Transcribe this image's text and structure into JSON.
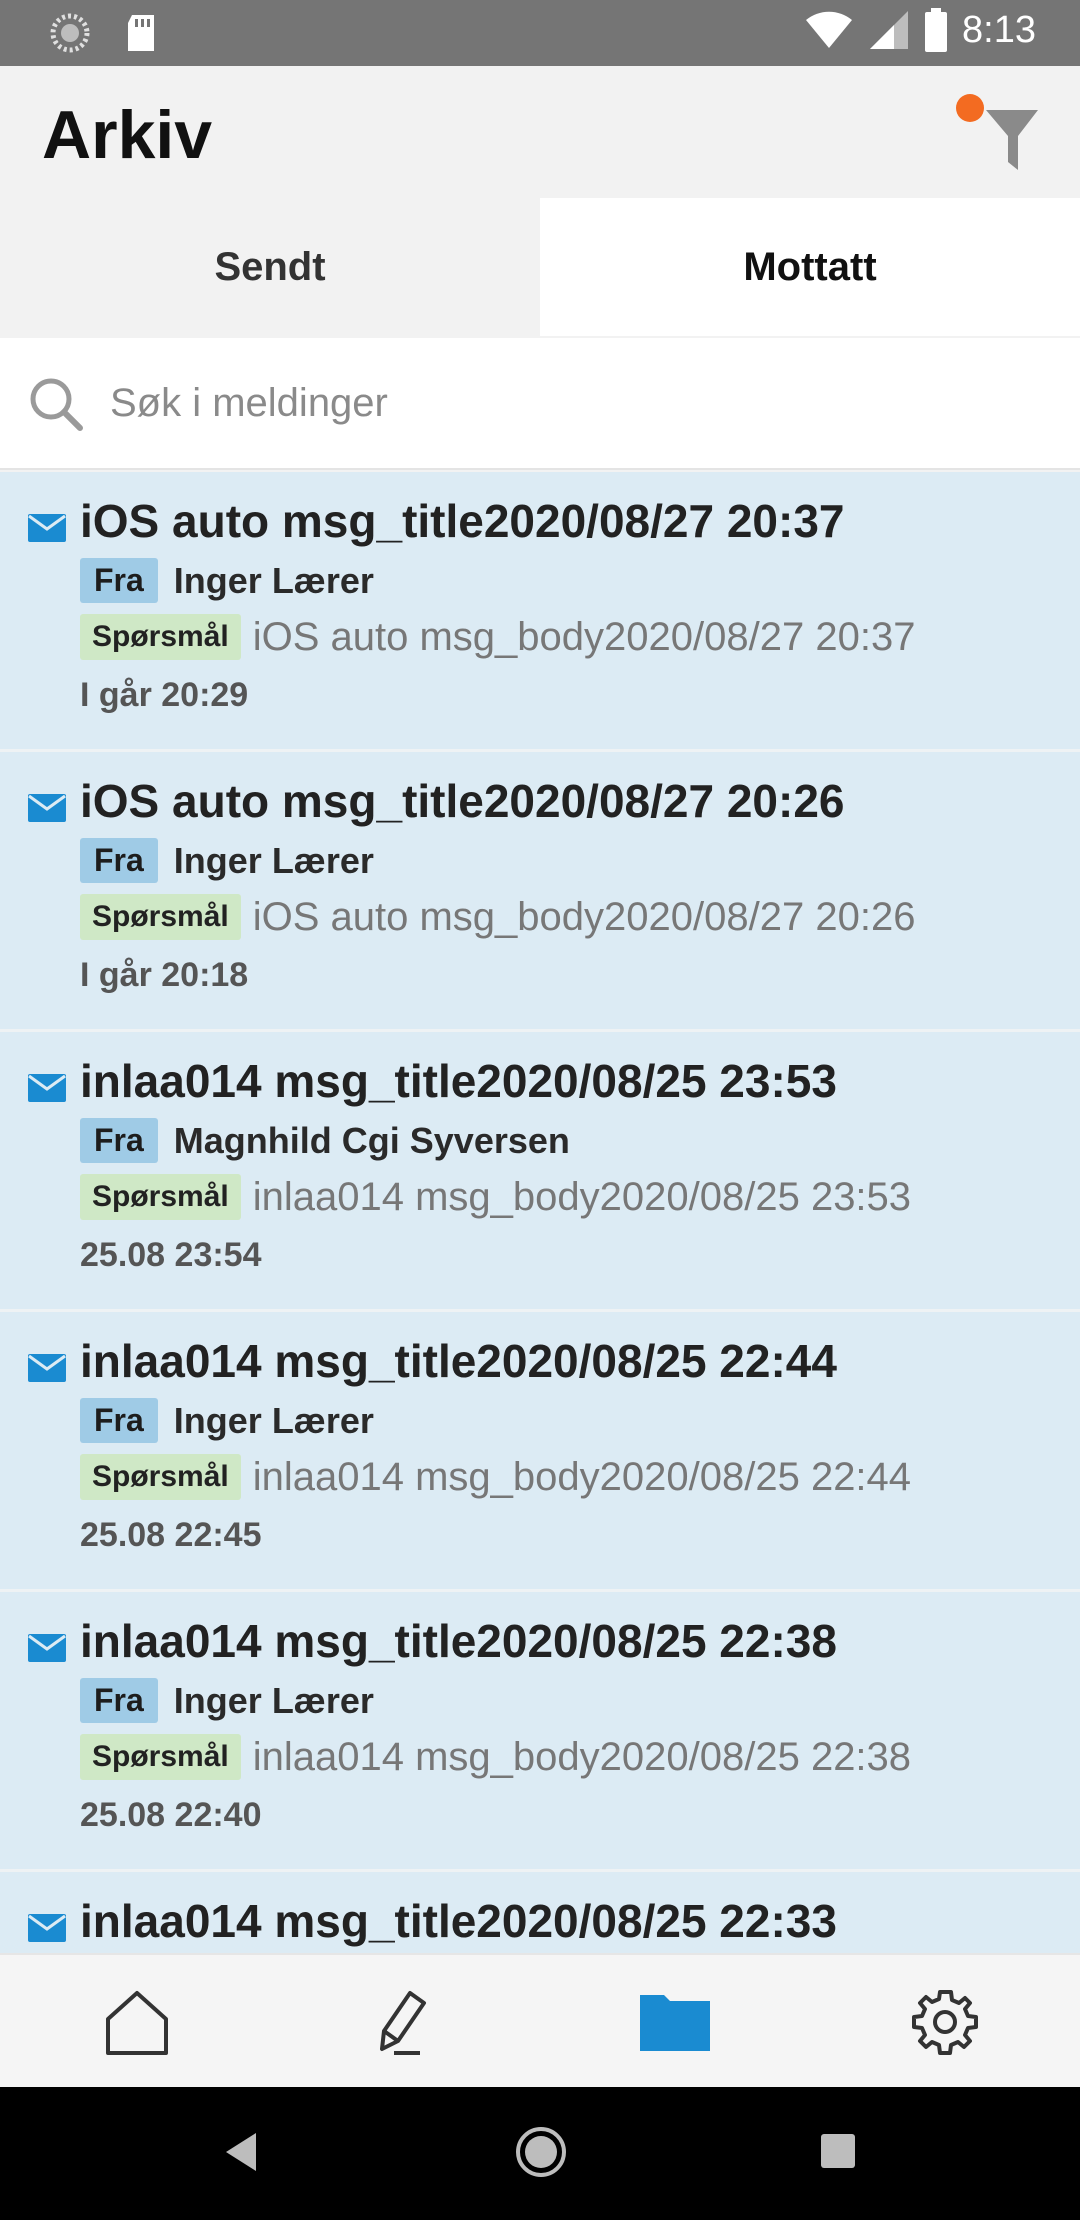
{
  "status_bar": {
    "time": "8:13",
    "icons": [
      "sync-icon",
      "sd-card-icon",
      "wifi-icon",
      "signal-icon",
      "battery-icon"
    ]
  },
  "header": {
    "title": "Arkiv",
    "filter_icon": "filter-icon",
    "filter_badge_color": "#f36b21"
  },
  "tabs": [
    {
      "label": "Sendt",
      "active": false
    },
    {
      "label": "Mottatt",
      "active": true
    }
  ],
  "search": {
    "placeholder": "Søk i meldinger",
    "value": ""
  },
  "messages": [
    {
      "title": "iOS auto msg_title2020/08/27 20:37",
      "from_label": "Fra",
      "sender": "Inger Lærer",
      "tag": "Spørsmål",
      "preview": "iOS auto msg_body2020/08/27 20:37",
      "time": "I går 20:29"
    },
    {
      "title": "iOS auto msg_title2020/08/27 20:26",
      "from_label": "Fra",
      "sender": "Inger Lærer",
      "tag": "Spørsmål",
      "preview": "iOS auto msg_body2020/08/27 20:26",
      "time": "I går 20:18"
    },
    {
      "title": "inlaa014 msg_title2020/08/25 23:53",
      "from_label": "Fra",
      "sender": "Magnhild Cgi Syversen",
      "tag": "Spørsmål",
      "preview": "inlaa014 msg_body2020/08/25 23:53",
      "time": "25.08 23:54"
    },
    {
      "title": "inlaa014 msg_title2020/08/25 22:44",
      "from_label": "Fra",
      "sender": "Inger Lærer",
      "tag": "Spørsmål",
      "preview": "inlaa014 msg_body2020/08/25 22:44",
      "time": "25.08 22:45"
    },
    {
      "title": "inlaa014 msg_title2020/08/25 22:38",
      "from_label": "Fra",
      "sender": "Inger Lærer",
      "tag": "Spørsmål",
      "preview": "inlaa014 msg_body2020/08/25 22:38",
      "time": "25.08 22:40"
    },
    {
      "title": "inlaa014 msg_title2020/08/25 22:33",
      "from_label": "",
      "sender": "",
      "tag": "",
      "preview": "",
      "time": ""
    }
  ],
  "bottom_nav": [
    {
      "icon": "home-icon",
      "active": false
    },
    {
      "icon": "compose-icon",
      "active": false
    },
    {
      "icon": "folder-icon",
      "active": true
    },
    {
      "icon": "settings-icon",
      "active": false
    }
  ],
  "colors": {
    "accent": "#1a8bd1",
    "list_background": "#dcebf4",
    "from_tag": "#9fcbe6",
    "question_tag": "#cfe8c6"
  }
}
